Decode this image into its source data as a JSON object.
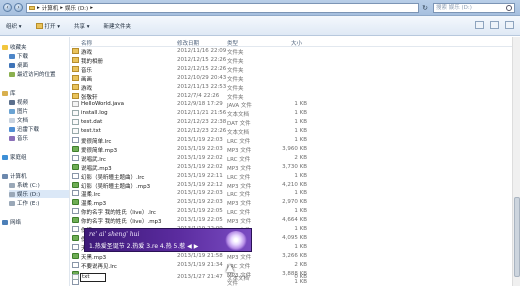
{
  "address_bar": {
    "segments": [
      "计算机",
      "娱乐 (D:)"
    ]
  },
  "search": {
    "placeholder": "搜索 娱乐 (D:)"
  },
  "toolbar": {
    "organize": "组织 ▾",
    "open": "打开 ▾",
    "share": "共享 ▾",
    "new_folder": "新建文件夹"
  },
  "nav": {
    "favorites": "收藏夹",
    "downloads": "下载",
    "desktop": "桌面",
    "recent": "最近访问的位置",
    "libraries": "库",
    "video": "视频",
    "pictures": "图片",
    "documents": "文档",
    "thunder": "迅雷下载",
    "music": "音乐",
    "homegroup": "家庭组",
    "computer": "计算机",
    "sys_c": "系统 (C:)",
    "ent_d": "娱乐 (D:)",
    "work_e": "工作 (E:)",
    "network": "网络"
  },
  "columns": {
    "name": "名称",
    "date": "修改日期",
    "type": "类型",
    "size": "大小"
  },
  "files": [
    {
      "name": "游戏",
      "date": "2012/11/16 22:09",
      "type": "文件夹",
      "size": "",
      "icon": "folder"
    },
    {
      "name": "我的相册",
      "date": "2012/12/15 22:26",
      "type": "文件夹",
      "size": "",
      "icon": "folder"
    },
    {
      "name": "音乐",
      "date": "2012/12/15 22:26",
      "type": "文件夹",
      "size": "",
      "icon": "folder"
    },
    {
      "name": "画画",
      "date": "2012/10/29 20:43",
      "type": "文件夹",
      "size": "",
      "icon": "folder"
    },
    {
      "name": "游戏",
      "date": "2012/11/13 22:53",
      "type": "文件夹",
      "size": "",
      "icon": "folder"
    },
    {
      "name": "张敬轩",
      "date": "2012/7/4 22:26",
      "type": "文件夹",
      "size": "",
      "icon": "folder"
    },
    {
      "name": "HelloWorld.java",
      "date": "2012/9/18 17:29",
      "type": "JAVA 文件",
      "size": "1 KB",
      "icon": "java"
    },
    {
      "name": "install.log",
      "date": "2012/11/21 21:56",
      "type": "文本文档",
      "size": "1 KB",
      "icon": "doc"
    },
    {
      "name": "test.dat",
      "date": "2012/12/23 22:38",
      "type": "DAT 文件",
      "size": "1 KB",
      "icon": "doc"
    },
    {
      "name": "test.txt",
      "date": "2012/12/23 22:26",
      "type": "文本文档",
      "size": "1 KB",
      "icon": "doc"
    },
    {
      "name": "爱很简单.lrc",
      "date": "2013/1/19 22:03",
      "type": "LRC 文件",
      "size": "1 KB",
      "icon": "lrc"
    },
    {
      "name": "爱很简单.mp3",
      "date": "2013/1/19 22:03",
      "type": "MP3 文件",
      "size": "3,960 KB",
      "icon": "mp3"
    },
    {
      "name": "说唱武.lrc",
      "date": "2013/1/19 22:02",
      "type": "LRC 文件",
      "size": "2 KB",
      "icon": "lrc"
    },
    {
      "name": "说唱武.mp3",
      "date": "2013/1/19 22:02",
      "type": "MP3 文件",
      "size": "3,730 KB",
      "icon": "mp3"
    },
    {
      "name": "幻影（吴昕瞳主题曲）.lrc",
      "date": "2013/1/19 22:11",
      "type": "LRC 文件",
      "size": "1 KB",
      "icon": "lrc"
    },
    {
      "name": "幻影（吴昕瞳主题曲）.mp3",
      "date": "2013/1/19 22:12",
      "type": "MP3 文件",
      "size": "4,210 KB",
      "icon": "mp3"
    },
    {
      "name": "温柔.lrc",
      "date": "2013/1/19 22:03",
      "type": "LRC 文件",
      "size": "1 KB",
      "icon": "lrc"
    },
    {
      "name": "温柔.mp3",
      "date": "2013/1/19 22:03",
      "type": "MP3 文件",
      "size": "2,970 KB",
      "icon": "mp3"
    },
    {
      "name": "你的名字 我的姓氏（live）.lrc",
      "date": "2013/1/19 22:05",
      "type": "LRC 文件",
      "size": "1 KB",
      "icon": "lrc"
    },
    {
      "name": "你的名字 我的姓氏（live）.mp3",
      "date": "2013/1/19 22:05",
      "type": "MP3 文件",
      "size": "4,664 KB",
      "icon": "mp3"
    },
    {
      "name": "伤情.lrc",
      "date": "2013/1/19 22:09",
      "type": "LRC 文件",
      "size": "1 KB",
      "icon": "lrc"
    },
    {
      "name": "伤情.mp3",
      "date": "2013/1/19 22:09",
      "type": "MP3 文件",
      "size": "4,095 KB",
      "icon": "mp3"
    },
    {
      "name": "天黑.lrc",
      "date": "2013/1/19 21:58",
      "type": "LRC 文件",
      "size": "1 KB",
      "icon": "lrc"
    },
    {
      "name": "天黑.mp3",
      "date": "2013/1/19 21:58",
      "type": "MP3 文件",
      "size": "3,266 KB",
      "icon": "mp3"
    },
    {
      "name": "不要说再见.lrc",
      "date": "2013/1/19 21:34",
      "type": "LRC 文件",
      "size": "2 KB",
      "icon": "lrc"
    },
    {
      "name": "",
      "date": "",
      "type": "MP3 文件",
      "size": "3,888 KB",
      "icon": "mp3"
    },
    {
      "name": "",
      "date": "",
      "type": "文件",
      "size": "1 KB",
      "icon": "lrc"
    },
    {
      "name": "",
      "date": "",
      "type": "",
      "size": "4,344 KB",
      "icon": "mp3"
    }
  ],
  "rename": {
    "value": "txt",
    "date": "2013/1/27 21:47",
    "type": "文本文档",
    "size": "0 KB"
  },
  "ime": {
    "composition": "re' ai' sheng' hui",
    "candidates": "1.热爱圣诞节 2.热爱 3.re 4.热 5.惹 ◀ ▶"
  }
}
